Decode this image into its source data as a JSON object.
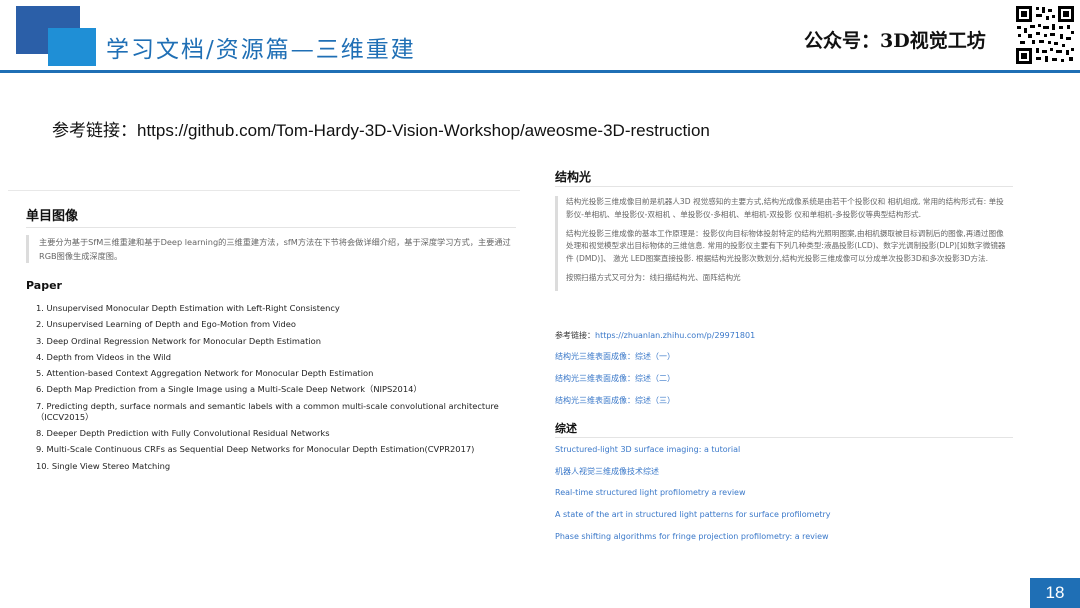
{
  "header": {
    "title": "学习文档/资源篇—三维重建",
    "brand": "公众号：3D视觉工坊"
  },
  "reference": {
    "label": "参考链接：",
    "url": "https://github.com/Tom-Hardy-3D-Vision-Workshop/aweosme-3D-restruction"
  },
  "left_panel": {
    "heading": "单目图像",
    "quote": "主要分为基于SfM三维重建和基于Deep learning的三维重建方法，sfM方法在下节将会做详细介绍，基于深度学习方式，主要通过RGB图像生成深度图。",
    "paper_heading": "Paper",
    "papers": [
      "1. Unsupervised Monocular Depth Estimation with Left-Right Consistency",
      "2. Unsupervised Learning of Depth and Ego-Motion from Video",
      "3. Deep Ordinal Regression Network for Monocular Depth Estimation",
      "4. Depth from Videos in the Wild",
      "5. Attention-based Context Aggregation Network for Monocular Depth Estimation",
      "6. Depth Map Prediction from a Single Image using a Multi-Scale Deep Network（NIPS2014）",
      "7. Predicting depth, surface normals and semantic labels with a common multi-scale convolutional architecture（ICCV2015）",
      "8. Deeper Depth Prediction with Fully Convolutional Residual Networks",
      "9. Multi-Scale Continuous CRFs as Sequential Deep Networks for Monocular Depth Estimation(CVPR2017)",
      "10. Single View Stereo Matching"
    ]
  },
  "right_panel": {
    "heading": "结构光",
    "quote_paragraphs": [
      "结构光投影三维成像目前是机器人3D 视觉感知的主要方式,结构光成像系统是由若干个投影仪和 相机组成, 常用的结构形式有: 单投影仪-单相机、单投影仪-双相机 、单投影仪-多相机、单相机-双投影 仪和单相机-多投影仪等典型结构形式.",
      "结构光投影三维成像的基本工作原理是：投影仪向目标物体投射特定的结构光照明图案,由相机摄取被目标调制后的图像,再通过图像处理和视觉模型求出目标物体的三维信息. 常用的投影仪主要有下列几种类型:液晶投影(LCD)、数字光调制投影(DLP)[如数字微镜器件 (DMD)]、 激光 LED图案直接投影. 根据结构光投影次数划分,结构光投影三维成像可以分成单次投影3D和多次投影3D方法.",
      "按照扫描方式又可分为：线扫描结构光、面阵结构光"
    ],
    "ref_label": "参考链接：",
    "ref_url": "https://zhuanlan.zhihu.com/p/29971801",
    "links": [
      "结构光三维表面成像：综述（一）",
      "结构光三维表面成像：综述（二）",
      "结构光三维表面成像：综述（三）"
    ],
    "review_heading": "综述",
    "review_links": [
      "Structured-light 3D surface imaging: a tutorial",
      "机器人视觉三维成像技术综述",
      "Real-time structured light profilometry a review",
      "A state of the art in structured light patterns for surface profilometry",
      "Phase shifting algorithms for fringe projection profilometry: a review"
    ]
  },
  "page_number": "18",
  "colors": {
    "accent_blue": "#1f6fb5",
    "dark_blue": "#2b5fa8",
    "light_blue": "#1f8fd6",
    "link_blue": "#3a78c9"
  }
}
